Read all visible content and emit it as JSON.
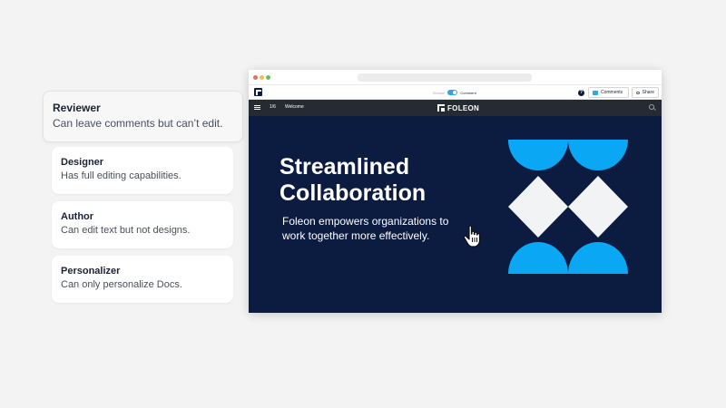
{
  "roles": [
    {
      "title": "Reviewer",
      "description": "Can leave comments but can’t edit."
    },
    {
      "title": "Designer",
      "description": "Has full editing capabilities."
    },
    {
      "title": "Author",
      "description": "Can edit text but not designs."
    },
    {
      "title": "Personalizer",
      "description": "Can only personalize Docs."
    }
  ],
  "toolbar": {
    "mode_browse": "Browse",
    "mode_comment": "Comment",
    "help_glyph": "?",
    "comments_label": "Comments",
    "share_label": "Share"
  },
  "navbar": {
    "page_count": "1/6",
    "page_name": "Welcome",
    "brand_name": "FOLEON"
  },
  "slide": {
    "headline_line1": "Streamlined",
    "headline_line2": "Collaboration",
    "subtext": "Foleon empowers organizations to work together more effectively."
  },
  "icons": [
    "menu-icon",
    "help-icon",
    "comment-icon",
    "link-icon",
    "search-icon",
    "hand-cursor-icon"
  ],
  "colors": {
    "slide_bg": "#0c1b40",
    "accent_blue": "#0aa7f5",
    "diamond": "#f2f3f5",
    "navbar_bg": "#262a33"
  }
}
